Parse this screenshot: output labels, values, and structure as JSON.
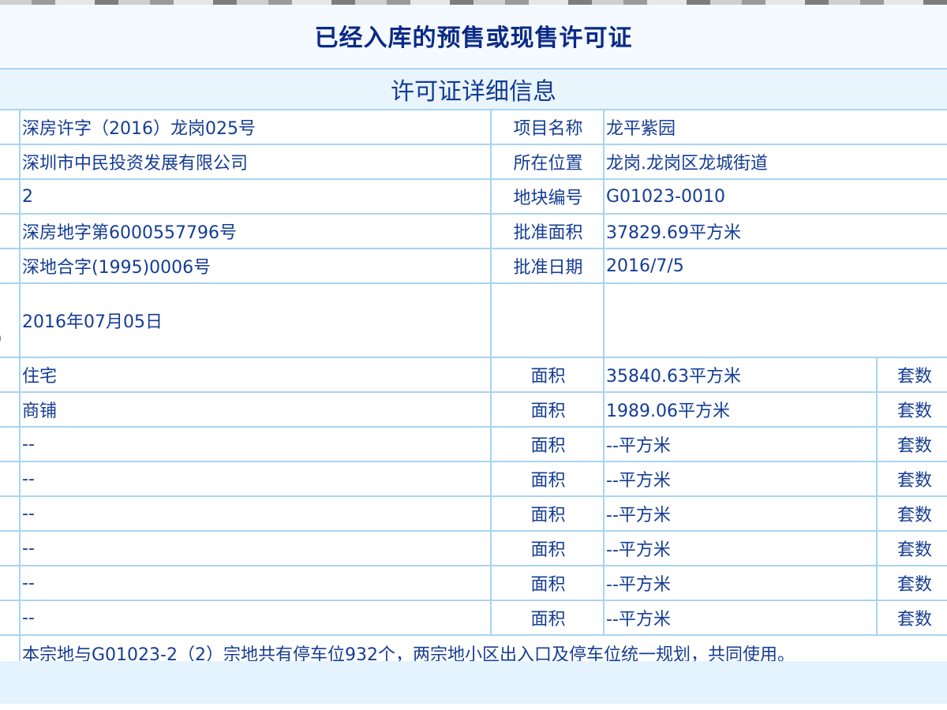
{
  "main_title": "已经入库的预售或现售许可证",
  "section_title": "许可证详细信息",
  "info_rows": [
    {
      "value": "深房许字（2016）龙岗025号",
      "label": "项目名称",
      "value2": "龙平紫园"
    },
    {
      "value": "深圳市中民投资发展有限公司",
      "label": "所在位置",
      "value2": "龙岗.龙岗区龙城街道"
    },
    {
      "value": "2",
      "label": "地块编号",
      "value2": "G01023-0010"
    },
    {
      "value": "深房地字第6000557796号",
      "label": "批准面积",
      "value2": "37829.69平方米"
    },
    {
      "value": "深地合字(1995)0006号",
      "label": "批准日期",
      "value2": "2016/7/5"
    }
  ],
  "issue_date": {
    "side_char": ")",
    "value": "2016年07月05日"
  },
  "usage_rows": [
    {
      "use": "住宅",
      "area_label": "面积",
      "area": "35840.63平方米",
      "units_label": "套数"
    },
    {
      "use": "商铺",
      "area_label": "面积",
      "area": "1989.06平方米",
      "units_label": "套数"
    },
    {
      "use": "--",
      "area_label": "面积",
      "area": "--平方米",
      "units_label": "套数"
    },
    {
      "use": "--",
      "area_label": "面积",
      "area": "--平方米",
      "units_label": "套数"
    },
    {
      "use": "--",
      "area_label": "面积",
      "area": "--平方米",
      "units_label": "套数"
    },
    {
      "use": "--",
      "area_label": "面积",
      "area": "--平方米",
      "units_label": "套数"
    },
    {
      "use": "--",
      "area_label": "面积",
      "area": "--平方米",
      "units_label": "套数"
    },
    {
      "use": "--",
      "area_label": "面积",
      "area": "--平方米",
      "units_label": "套数"
    }
  ],
  "remark": "本宗地与G01023-2（2）宗地共有停车位932个，两宗地小区出入口及停车位统一规划，共同使用。"
}
